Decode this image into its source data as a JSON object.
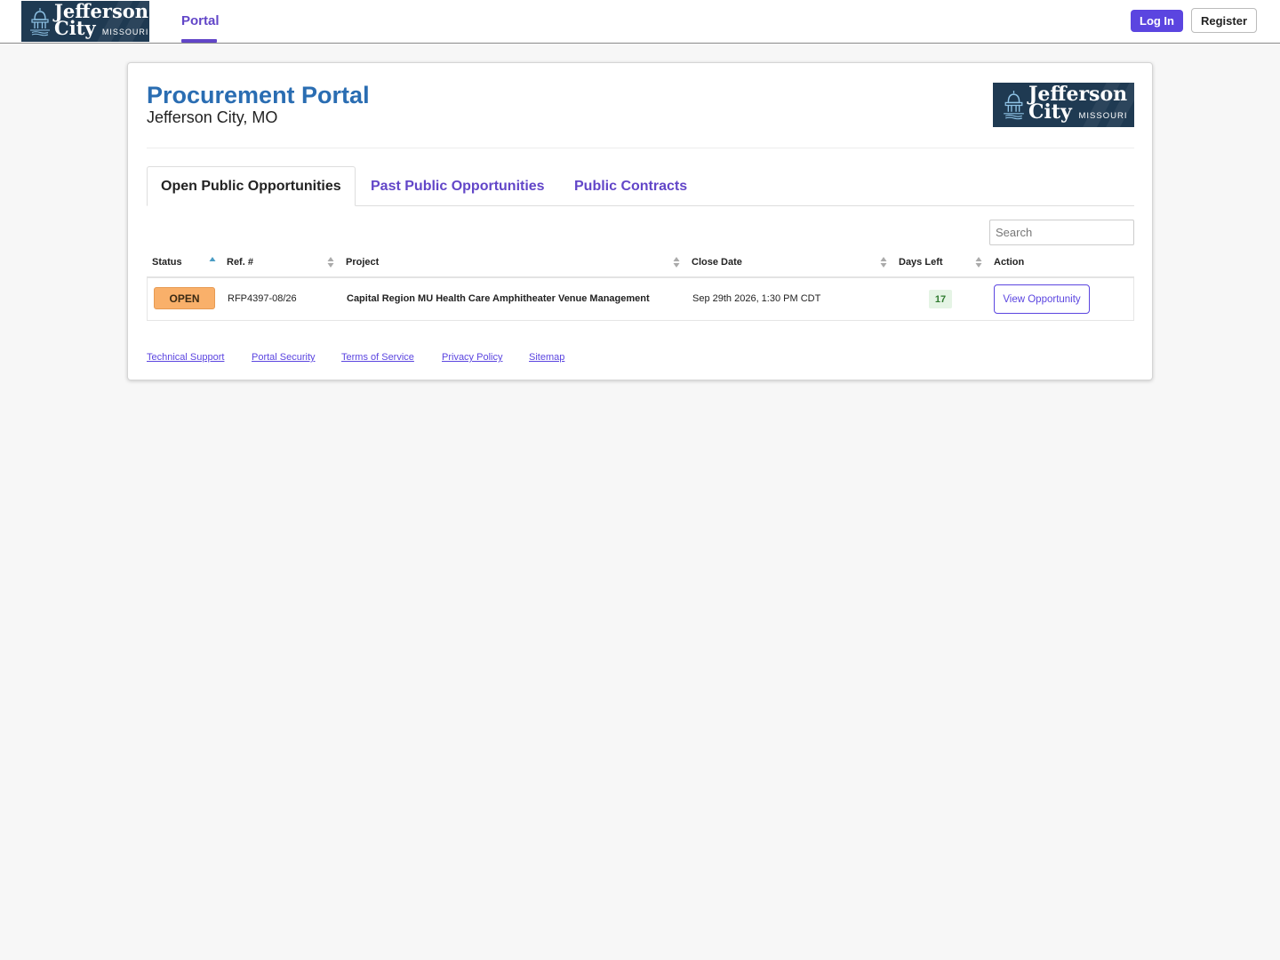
{
  "nav": {
    "logo": {
      "line1": "Jefferson",
      "line2": "City",
      "state": "MISSOURI"
    },
    "tab_label": "Portal",
    "login_label": "Log In",
    "register_label": "Register"
  },
  "header": {
    "title": "Procurement Portal",
    "subtitle": "Jefferson City, MO",
    "logo": {
      "line1": "Jefferson",
      "line2": "City",
      "state": "MISSOURI"
    }
  },
  "tabs": [
    {
      "label": "Open Public Opportunities",
      "active": true
    },
    {
      "label": "Past Public Opportunities",
      "active": false
    },
    {
      "label": "Public Contracts",
      "active": false
    }
  ],
  "search": {
    "placeholder": "Search",
    "value": ""
  },
  "table": {
    "columns": [
      "Status",
      "Ref. #",
      "Project",
      "Close Date",
      "Days Left",
      "Action"
    ],
    "rows": [
      {
        "status": "OPEN",
        "ref": "RFP4397-08/26",
        "project": "Capital Region MU Health Care Amphitheater Venue Management",
        "close_date": "Sep 29th 2026, 1:30 PM CDT",
        "days_left": "17",
        "action_label": "View Opportunity"
      }
    ]
  },
  "footer": {
    "links": [
      "Technical Support",
      "Portal Security",
      "Terms of Service",
      "Privacy Policy",
      "Sitemap"
    ]
  },
  "icons": {
    "sort_icon": "sort-icon",
    "sort_asc_icon": "sort-ascending-icon",
    "logo_mark": "capitol-dome-icon"
  },
  "colors": {
    "accent": "#5b45e0",
    "tab": "#6246c8",
    "title": "#2a6db2",
    "logo_bg": "#1f3a52",
    "open_badge": "#f9b06a",
    "days_badge_bg": "#e5f4e5",
    "days_badge_text": "#2f7a2f"
  }
}
